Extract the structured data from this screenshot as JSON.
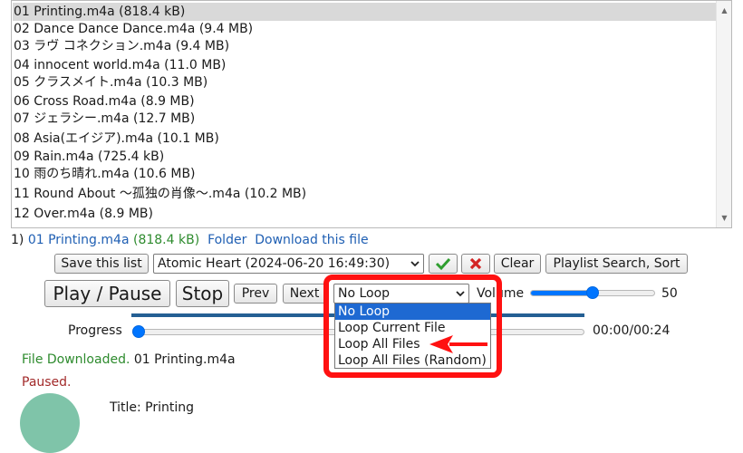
{
  "playlist": {
    "items": [
      "01 Printing.m4a (818.4 kB)",
      "02 Dance Dance Dance.m4a (9.4 MB)",
      "03 ラヴ コネクション.m4a (9.4 MB)",
      "04 innocent world.m4a (11.0 MB)",
      "05 クラスメイト.m4a (10.3 MB)",
      "06 Cross Road.m4a (8.9 MB)",
      "07 ジェラシー.m4a (12.7 MB)",
      "08 Asia(エイジア).m4a (10.1 MB)",
      "09 Rain.m4a (725.4 kB)",
      "10 雨のち晴れ.m4a (10.6 MB)",
      "11 Round About ～孤独の肖像～.m4a (10.2 MB)",
      "12 Over.m4a (8.9 MB)"
    ],
    "selected_index": 0
  },
  "now": {
    "index": "1)",
    "filename": "01 Printing.m4a",
    "size": "(818.4 kB)",
    "folder_link": "Folder",
    "download_link": "Download this file"
  },
  "toolbar": {
    "save_list": "Save this list",
    "saved_list_selected": "Atomic Heart (2024-06-20 16:49:30)",
    "clear": "Clear",
    "search_sort": "Playlist Search, Sort"
  },
  "controls": {
    "play_pause": "Play / Pause",
    "stop": "Stop",
    "prev": "Prev",
    "next": "Next",
    "loop_selected": "No Loop",
    "volume_label": "Volume",
    "volume_value": "50",
    "volume_level": 0.5
  },
  "loop_options": [
    "No Loop",
    "Loop Current File",
    "Loop All Files",
    "Loop All Files (Random)"
  ],
  "loop_highlight_index": 0,
  "progress": {
    "label": "Progress",
    "time": "00:00/00:24",
    "level": 0
  },
  "status": {
    "downloaded_prefix": "File Downloaded.",
    "downloaded_file": "01 Printing.m4a",
    "paused": "Paused."
  },
  "meta": {
    "title_line": "Title: Printing"
  },
  "colors": {
    "accent": "#0075ff",
    "link": "#1f5fb3",
    "success": "#2e8b2e",
    "paused": "#a22a2a",
    "annotation": "#ff1111",
    "option_highlight": "#1e69d2"
  },
  "icons": {
    "confirm": "check-icon",
    "delete": "x-icon",
    "annotation_arrow": "red-arrow-icon"
  }
}
